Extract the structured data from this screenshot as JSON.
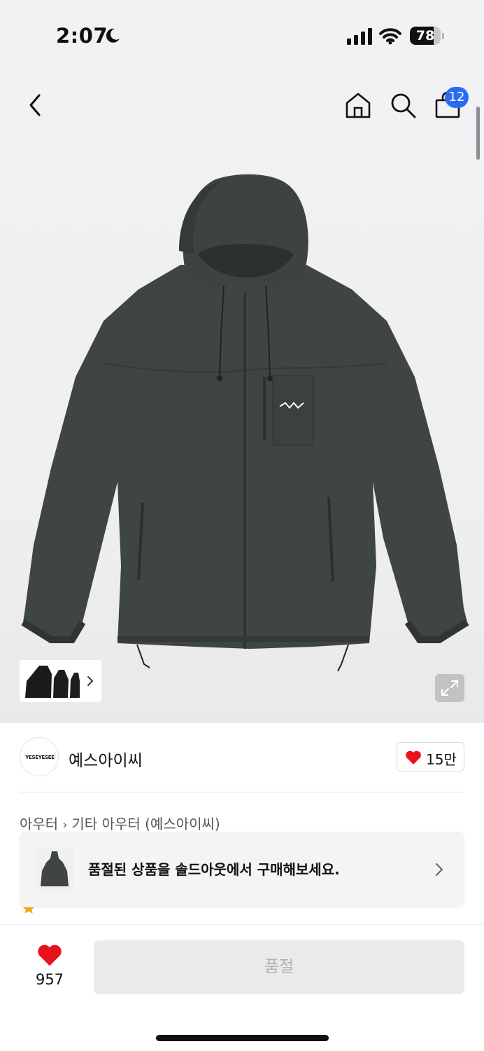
{
  "status_bar": {
    "time": "2:07",
    "battery": "78",
    "battery_level": 0.78
  },
  "header": {
    "back_icon": "chevron-left-icon",
    "home_icon": "home-icon",
    "search_icon": "search-icon",
    "bag_icon": "shopping-bag-icon",
    "bag_badge": "12",
    "badge_color": "#2a6cf0"
  },
  "gallery": {
    "expand_icon": "expand-icon",
    "thumb_more_icon": "chevron-right-icon"
  },
  "brand": {
    "logo_text": "YESEYESEE",
    "name": "예스아이씨",
    "like_count": "15만",
    "heart_color": "#e8111c"
  },
  "breadcrumb": {
    "level1": "아우터",
    "level2": "기타 아우터 (예스아이씨)"
  },
  "toast": {
    "text": "품절된 상품을 솔드아웃에서 구매해보세요."
  },
  "bottom_bar": {
    "wish_count": "957",
    "buy_button": "품절"
  }
}
